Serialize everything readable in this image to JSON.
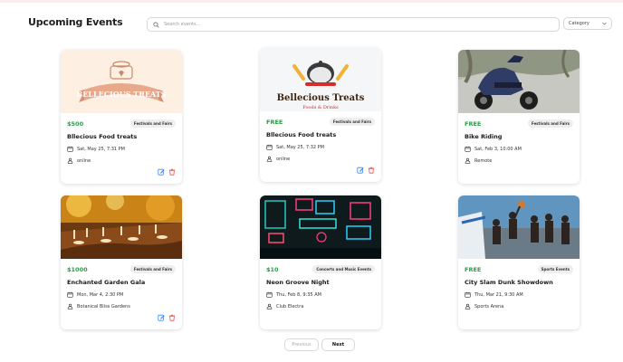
{
  "header": {
    "title": "Upcoming Events",
    "search_placeholder": "Search events...",
    "category_label": "Category"
  },
  "events": [
    {
      "price": "$500",
      "category": "Festivals and Fairs",
      "title": "Bllecious Food treats",
      "date": "Sat, May 25, 7:31 PM",
      "location": "online",
      "image_text": "BELLECIOUS TREATS",
      "editable": true
    },
    {
      "price": "FREE",
      "category": "Festivals and Fairs",
      "title": "Bllecious Food treats",
      "date": "Sat, May 25, 7:32 PM",
      "location": "online",
      "image_text": "Bellecious Treats",
      "image_subtext": "Foods & Drinks",
      "editable": true
    },
    {
      "price": "FREE",
      "category": "Festivals and Fairs",
      "title": "Bike Riding",
      "date": "Sat, Feb 3, 10:00 AM",
      "location": "Remote",
      "editable": false
    },
    {
      "price": "$1000",
      "category": "Festivals and Fairs",
      "title": "Enchanted Garden Gala",
      "date": "Mon, Mar 4, 2:30 PM",
      "location": "Botanical Bliss Gardens",
      "editable": true
    },
    {
      "price": "$10",
      "category": "Concerts and Music Events",
      "title": "Neon Groove Night",
      "date": "Thu, Feb 8, 9:35 AM",
      "location": "Club Electra",
      "editable": false
    },
    {
      "price": "FREE",
      "category": "Sports Events",
      "title": "City Slam Dunk Showdown",
      "date": "Thu, Mar 21, 9:30 AM",
      "location": "Sports Arena",
      "editable": false
    }
  ],
  "pagination": {
    "previous": "Previous",
    "next": "Next"
  },
  "colors": {
    "price": "#2e9a47",
    "edit": "#3b82f6",
    "delete": "#e55353"
  },
  "icons": {
    "search": "search-icon",
    "chevron": "chevron-down-icon",
    "date": "calendar-icon",
    "location": "person-pin-icon",
    "edit": "edit-icon",
    "delete": "trash-icon"
  }
}
